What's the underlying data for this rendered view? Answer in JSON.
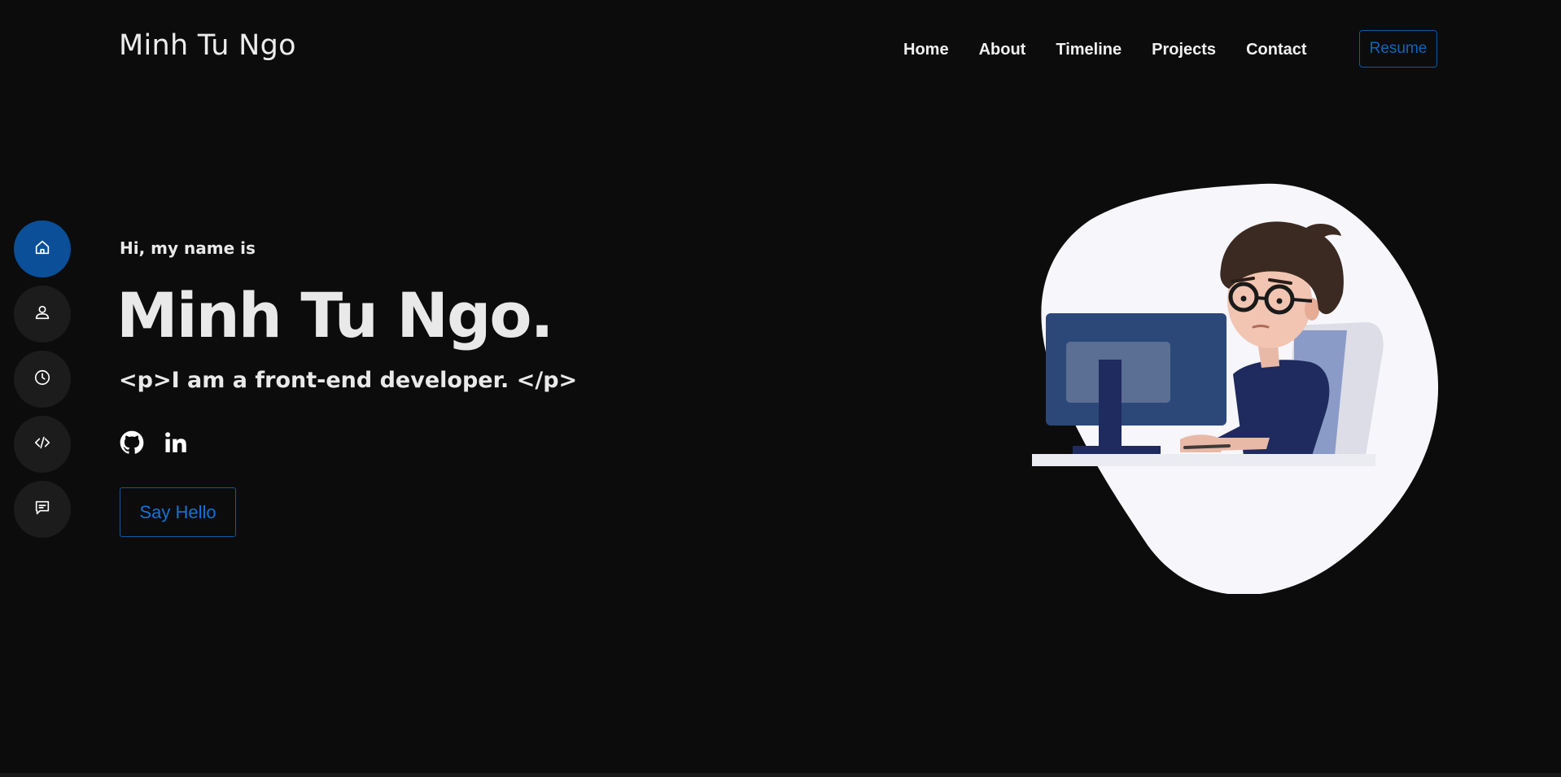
{
  "header": {
    "brand": "Minh Tu Ngo",
    "nav": [
      {
        "label": "Home"
      },
      {
        "label": "About"
      },
      {
        "label": "Timeline"
      },
      {
        "label": "Projects"
      },
      {
        "label": "Contact"
      }
    ],
    "resume_label": "Resume"
  },
  "side_nav": [
    {
      "icon": "home-icon",
      "active": true
    },
    {
      "icon": "user-icon",
      "active": false
    },
    {
      "icon": "clock-icon",
      "active": false
    },
    {
      "icon": "code-icon",
      "active": false
    },
    {
      "icon": "message-icon",
      "active": false
    }
  ],
  "hero": {
    "greeting": "Hi, my name is",
    "name": "Minh Tu Ngo.",
    "tagline": "<p>I am a front-end developer. </p>",
    "socials": [
      {
        "icon": "github-icon"
      },
      {
        "icon": "linkedin-icon"
      }
    ],
    "cta_label": "Say Hello"
  },
  "colors": {
    "background": "#0c0c0c",
    "accent": "#0a4f98",
    "accent_text": "#1473d6",
    "text": "#e9e9e9",
    "side_button": "#1c1c1c"
  }
}
